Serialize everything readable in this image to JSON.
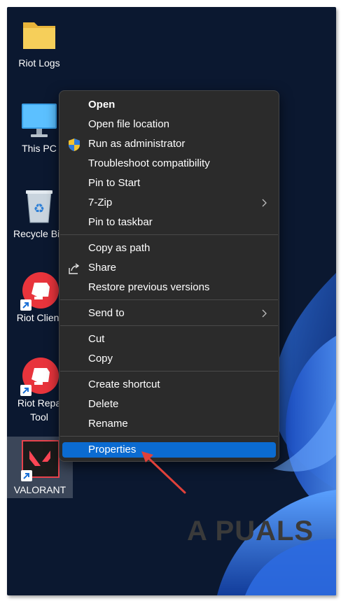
{
  "desktop_icons": [
    {
      "label": "Riot Logs",
      "icon": "folder-icon"
    },
    {
      "label": "This PC",
      "icon": "monitor-icon"
    },
    {
      "label": "Recycle Bin",
      "icon": "recycle-bin-icon"
    },
    {
      "label": "Riot Client",
      "icon": "riot-client-icon"
    },
    {
      "label": "Riot Repair Tool",
      "line1": "Riot Repa",
      "line2": "Tool",
      "icon": "riot-repair-icon"
    },
    {
      "label": "VALORANT",
      "icon": "valorant-icon"
    }
  ],
  "context_menu": {
    "items": [
      {
        "label": "Open",
        "bold": true
      },
      {
        "label": "Open file location"
      },
      {
        "label": "Run as administrator",
        "icon": "shield-icon"
      },
      {
        "label": "Troubleshoot compatibility"
      },
      {
        "label": "Pin to Start"
      },
      {
        "label": "7-Zip",
        "submenu": true
      },
      {
        "label": "Pin to taskbar"
      },
      {
        "label": "Copy as path"
      },
      {
        "label": "Share",
        "icon": "share-icon"
      },
      {
        "label": "Restore previous versions"
      },
      {
        "label": "Send to",
        "submenu": true
      },
      {
        "label": "Cut"
      },
      {
        "label": "Copy"
      },
      {
        "label": "Create shortcut"
      },
      {
        "label": "Delete"
      },
      {
        "label": "Rename"
      },
      {
        "label": "Properties",
        "highlighted": true
      }
    ]
  },
  "watermark": "A PUALS",
  "colors": {
    "menu_bg": "#2b2b2b",
    "highlight": "#0b6bd1",
    "arrow": "#e0413a",
    "riot_red": "#e8343c"
  }
}
